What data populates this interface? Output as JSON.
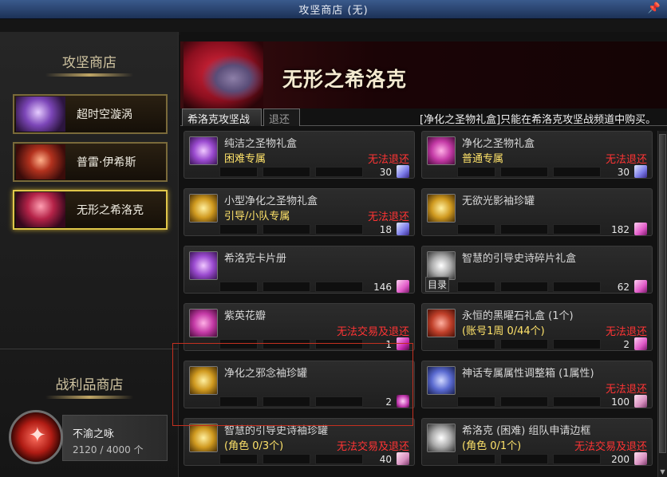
{
  "window": {
    "title": "攻坚商店 (无)",
    "pin_glyph": "📌"
  },
  "ghost_text": " ",
  "left": {
    "header": "攻坚商店",
    "shops": [
      {
        "label": "超时空漩涡",
        "icon": "vortex-portrait-icon"
      },
      {
        "label": "普雷·伊希斯",
        "icon": "prey-isys-portrait-icon"
      },
      {
        "label": "无形之希洛克",
        "icon": "sirocco-portrait-icon",
        "selected": true
      }
    ],
    "loot_header": "战利品商店",
    "token": {
      "name": "不渝之咏",
      "count": "2120 / 4000 个",
      "icon": "red-crest-medal-icon"
    }
  },
  "right": {
    "boss_name": "无形之希洛克",
    "tabs": [
      {
        "label": "希洛克攻坚战",
        "active": true
      },
      {
        "label": "退还",
        "active": false
      }
    ],
    "notice": "[净化之圣物礼盒]只能在希洛克攻坚战频道中购买。",
    "items": [
      {
        "name": "纯洁之圣物礼盒",
        "sub": "困难专属",
        "warn": "无法退还",
        "price": "30",
        "icon_color": "purple",
        "currency": "shard"
      },
      {
        "name": "净化之圣物礼盒",
        "sub": "普通专属",
        "warn": "无法退还",
        "price": "30",
        "icon_color": "pink",
        "currency": "shard"
      },
      {
        "name": "小型净化之圣物礼盒",
        "sub": "引导/小队专属",
        "warn": "无法退还",
        "price": "18",
        "icon_color": "gold",
        "currency": "shard"
      },
      {
        "name": "无欲光影袖珍罐",
        "sub": "",
        "warn": "",
        "price": "182",
        "icon_color": "gold",
        "currency": "fang"
      },
      {
        "name": "希洛克卡片册",
        "sub": "",
        "warn": "",
        "price": "146",
        "icon_color": "purple",
        "currency": "fang"
      },
      {
        "name": "智慧的引导史诗碎片礼盒",
        "sub": "",
        "warn": "",
        "price": "62",
        "icon_color": "white",
        "currency": "fang",
        "tag": "目录"
      },
      {
        "name": "紫英花瓣",
        "sub": "",
        "warn": "无法交易及退还",
        "price": "1",
        "icon_color": "pink",
        "currency": "pinkbox"
      },
      {
        "name": "永恒的黑曜石礼盒 (1个)",
        "sub": "(账号1周 0/44个)",
        "warn": "无法退还",
        "price": "2",
        "icon_color": "red",
        "currency": "fang"
      },
      {
        "name": "净化之邪念袖珍罐",
        "sub": "",
        "warn": "",
        "price": "2",
        "icon_color": "gold",
        "currency": "swirl"
      },
      {
        "name": "神话专属属性调整箱 (1属性)",
        "sub": "",
        "warn": "无法退还",
        "price": "100",
        "icon_color": "blue",
        "currency": "feather"
      },
      {
        "name": "智慧的引导史诗袖珍罐",
        "sub": "(角色 0/3个)",
        "warn": "无法交易及退还",
        "price": "40",
        "icon_color": "gold",
        "currency": "feather"
      },
      {
        "name": "希洛克 (困难) 组队申请边框",
        "sub": "(角色 0/1个)",
        "warn": "无法交易及退还",
        "price": "200",
        "icon_color": "white",
        "currency": "feather"
      }
    ]
  },
  "colors": {
    "warn": "#ff3434",
    "sub": "#ffe36a",
    "highlight": "#c43020",
    "selected_border": "#e0c64a"
  }
}
